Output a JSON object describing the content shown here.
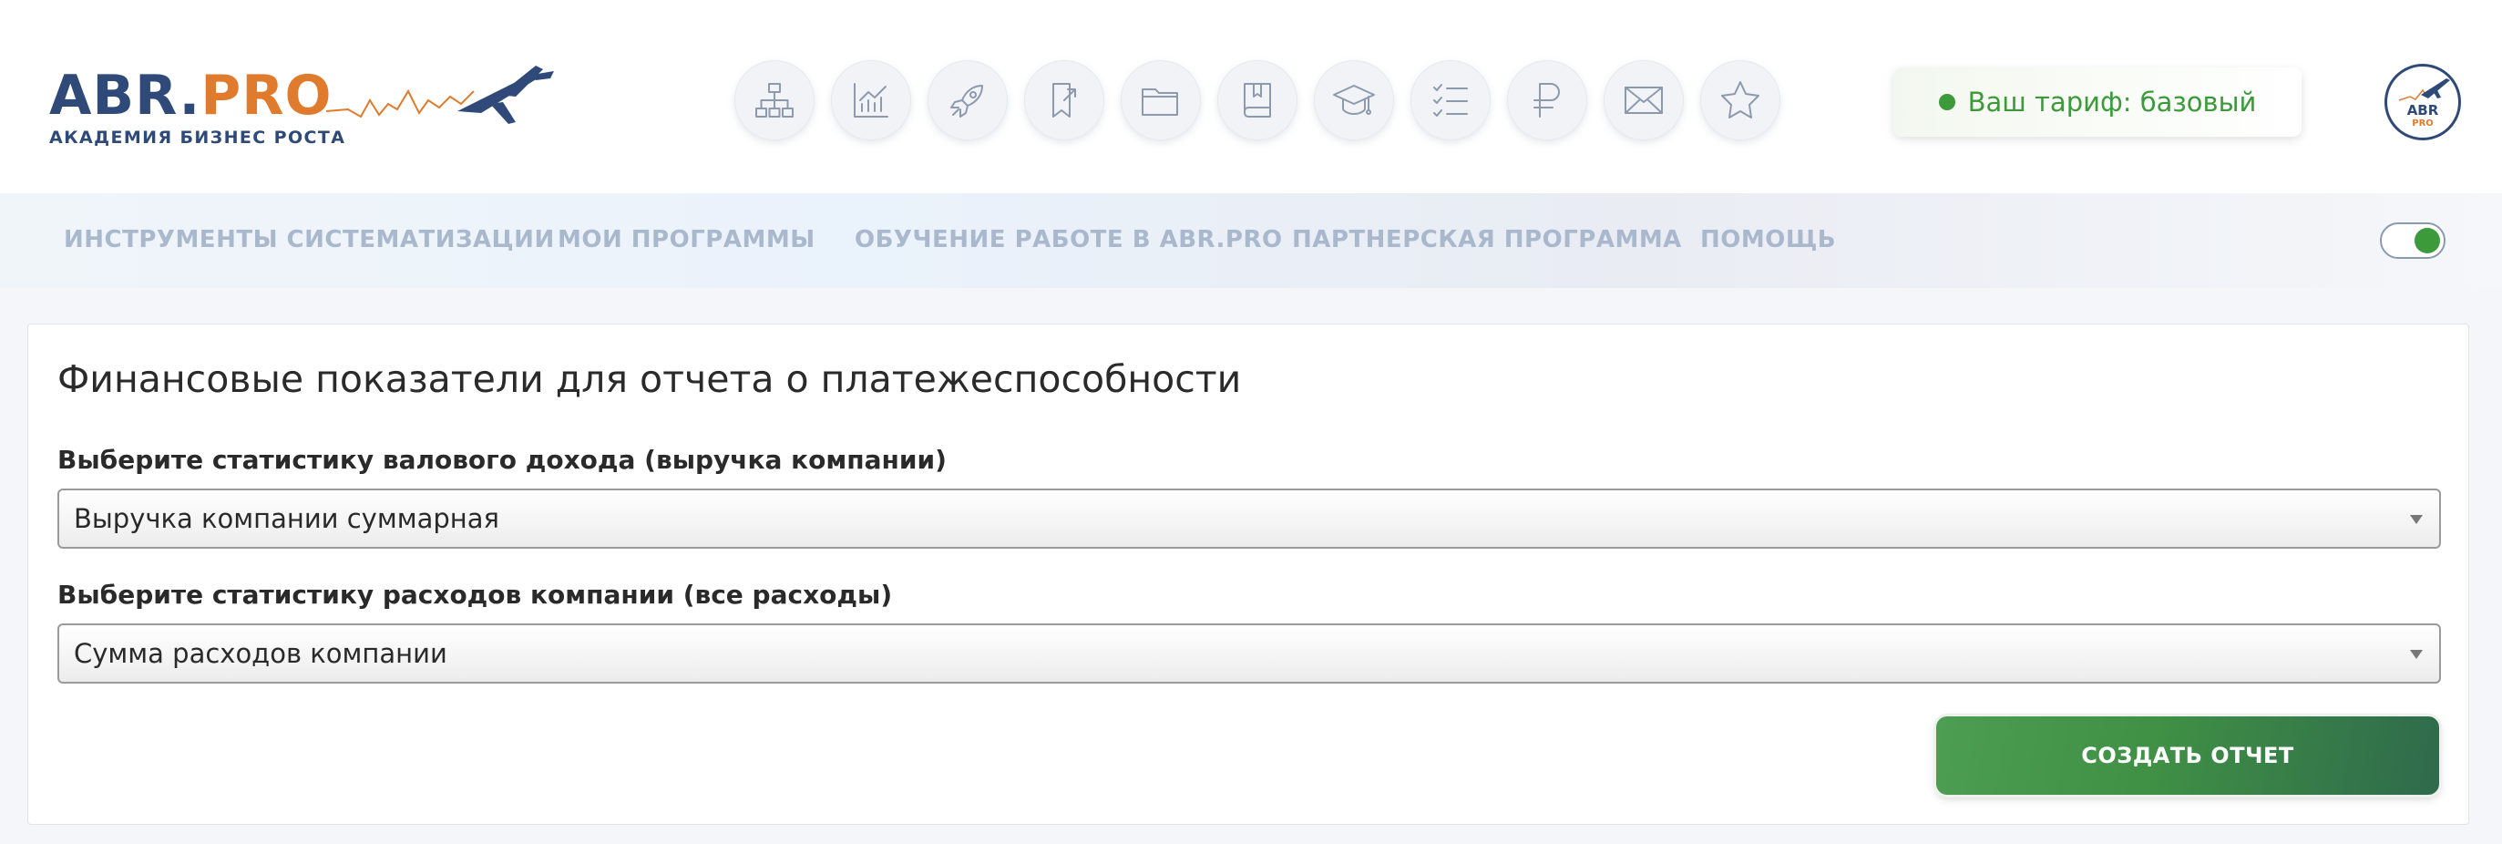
{
  "header": {
    "logo": {
      "brand_left": "ABR",
      "brand_dot": ".",
      "brand_right": "PRO",
      "subtitle": "АКАДЕМИЯ БИЗНЕС РОСТА"
    },
    "icons": [
      "sitemap-icon",
      "chart-icon",
      "rocket-icon",
      "bookmark-icon",
      "folder-icon",
      "book-icon",
      "graduation-cap-icon",
      "checklist-icon",
      "ruble-icon",
      "mail-icon",
      "star-icon"
    ],
    "tariff_label": "Ваш тариф: базовый",
    "avatar_text": "ABR PRO"
  },
  "nav": {
    "items": [
      "ИНСТРУМЕНТЫ СИСТЕМАТИЗАЦИИ",
      "МОИ ПРОГРАММЫ",
      "ОБУЧЕНИЕ РАБОТЕ В ABR.PRO",
      "ПАРТНЕРСКАЯ ПРОГРАММА",
      "ПОМОЩЬ"
    ],
    "toggle_on": true
  },
  "card": {
    "title": "Финансовые показатели для отчета о платежеспособности",
    "revenue_label": "Выберите статистику валового дохода (выручка компании)",
    "revenue_value": "Выручка компании суммарная",
    "expense_label": "Выберите статистику расходов компании (все расходы)",
    "expense_value": "Сумма расходов компании",
    "create_button": "СОЗДАТЬ ОТЧЕТ"
  },
  "colors": {
    "brand_blue": "#2f4a78",
    "brand_orange": "#e07b2e",
    "accent_green": "#3c9a3a",
    "nav_text": "#a9b8cc"
  }
}
